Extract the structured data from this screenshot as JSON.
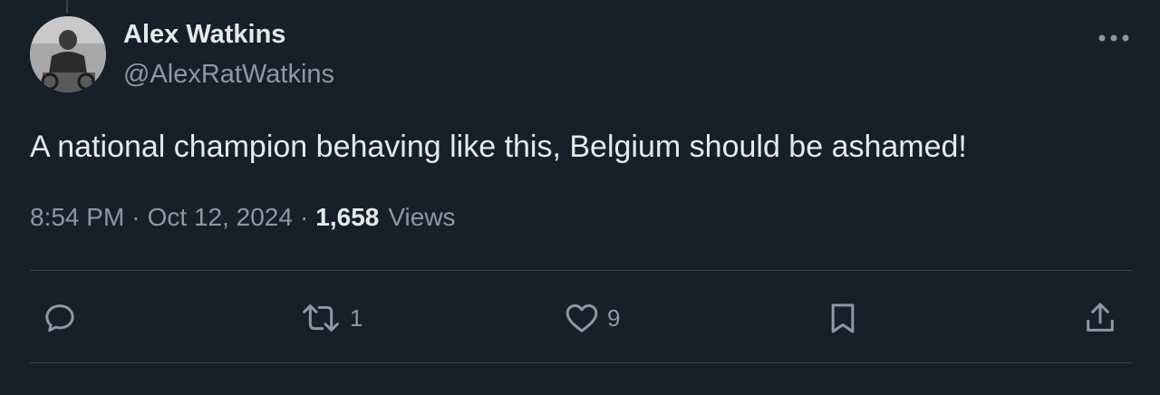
{
  "author": {
    "display_name": "Alex Watkins",
    "handle": "@AlexRatWatkins"
  },
  "tweet": {
    "text": "A national champion behaving like this, Belgium should be ashamed!",
    "time": "8:54 PM",
    "separator": "·",
    "date": "Oct 12, 2024",
    "views_count": "1,658",
    "views_label": "Views"
  },
  "actions": {
    "reply": {
      "icon": "reply-icon",
      "count": ""
    },
    "retweet": {
      "icon": "retweet-icon",
      "count": "1"
    },
    "like": {
      "icon": "heart-icon",
      "count": "9"
    },
    "bookmark": {
      "icon": "bookmark-icon",
      "count": ""
    },
    "share": {
      "icon": "share-icon",
      "count": ""
    }
  },
  "colors": {
    "background": "#15202b",
    "primary_text": "#e7e9ea",
    "secondary_text": "#8b98a5",
    "divider": "#38444d"
  }
}
